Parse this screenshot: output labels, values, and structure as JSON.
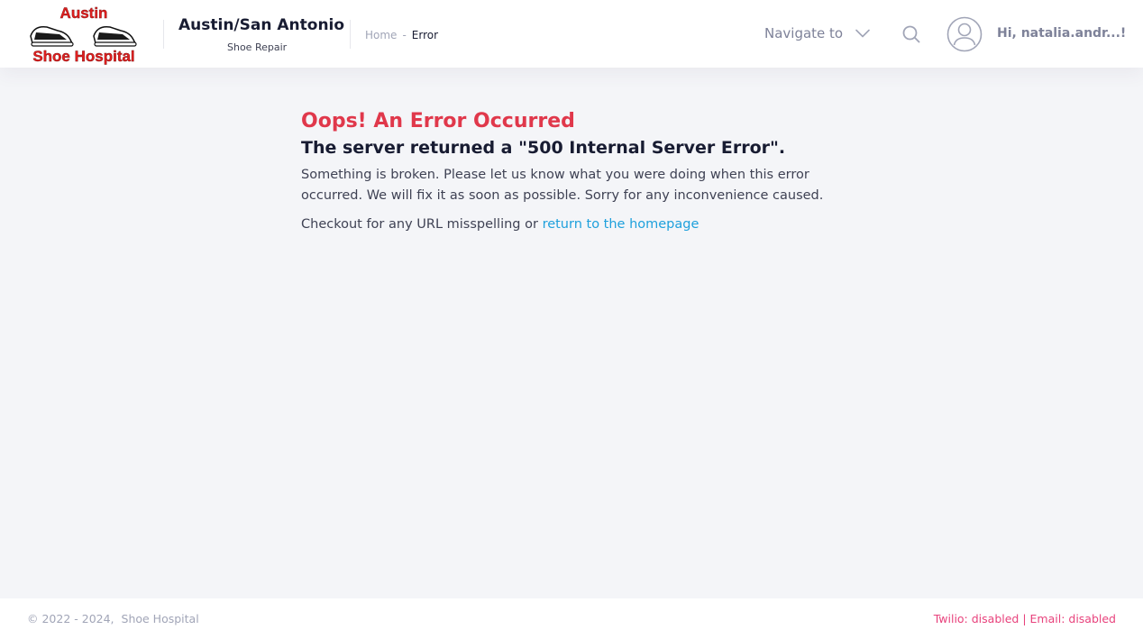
{
  "header": {
    "logo": {
      "line1": "Austin",
      "line2": "Shoe Hospital"
    },
    "brand_title": "Austin/San Antonio",
    "brand_subtitle": "Shoe Repair",
    "breadcrumb": {
      "home": "Home",
      "separator": "-",
      "current": "Error"
    },
    "navigate_label": "Navigate to",
    "greeting": "Hi, natalia.andr...!"
  },
  "icons": {
    "navigate": "chevron-down-icon",
    "search": "search-icon",
    "user": "user-avatar-icon"
  },
  "error": {
    "title": "Oops! An Error Occurred",
    "subtitle": "The server returned a \"500 Internal Server Error\".",
    "description": "Something is broken. Please let us know what you were doing when this error occurred. We will fix it as soon as possible. Sorry for any inconvenience caused.",
    "check_prefix": "Checkout for any URL misspelling or ",
    "homepage_link": "return to the homepage"
  },
  "footer": {
    "copyright": "© 2022 - 2024,",
    "brand": "Shoe Hospital",
    "status": "Twilio: disabled | Email: disabled"
  },
  "colors": {
    "error_title": "#e0384b",
    "link": "#1ea0dc",
    "status": "#e8427c",
    "page_bg": "#f4f5f8"
  }
}
